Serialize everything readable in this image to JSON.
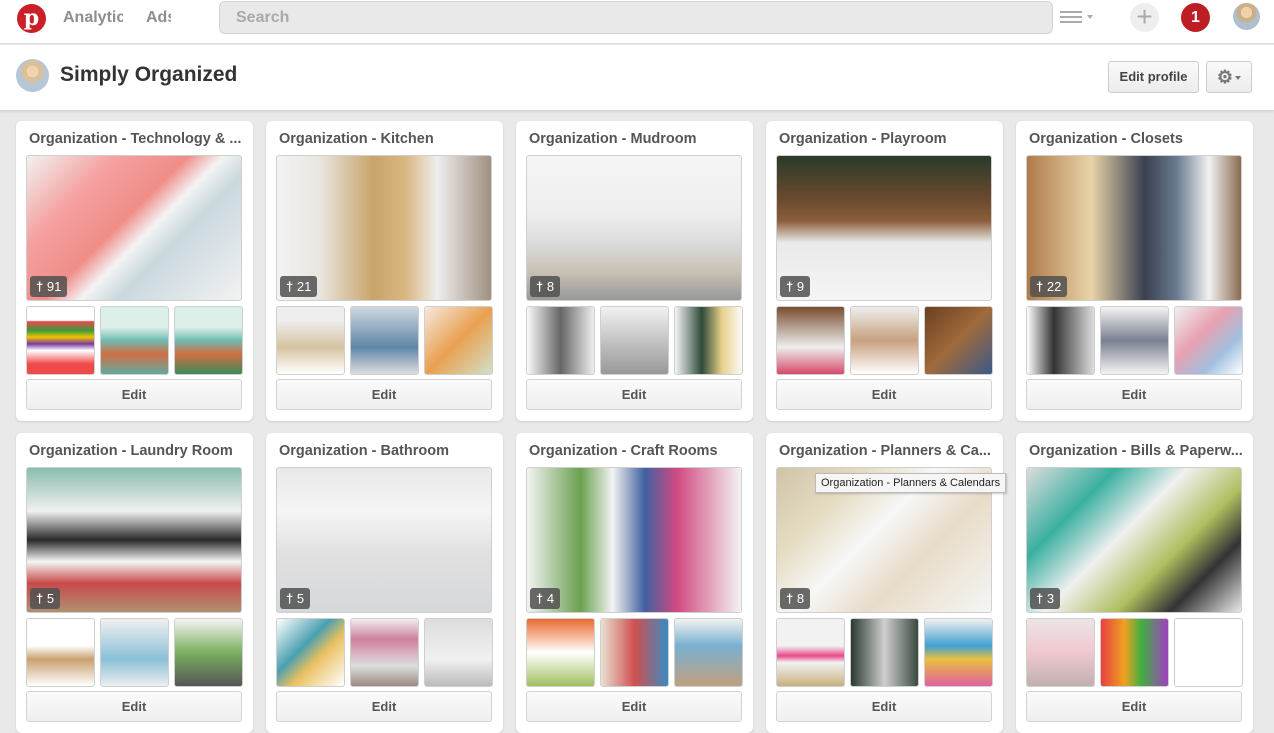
{
  "header": {
    "logo": "p",
    "nav": [
      "Analytic",
      "Ads"
    ],
    "search_placeholder": "Search",
    "add": "+",
    "notifications": "1"
  },
  "profile": {
    "name": "Simply Organized",
    "edit_profile": "Edit profile",
    "settings_icon": "⚙"
  },
  "boards": [
    {
      "title": "Organization - Technology & ...",
      "pins": "91",
      "edit": "Edit",
      "cover": "linear-gradient(135deg,#f1f1f1 0%,#f4a1a0 25%,#f08d88 45%,#f3f3f3 55%,#c9d8de 65%,#f2f2f2 100%)",
      "thumbs": [
        "linear-gradient(#fff 20%,#e64a4a 22%,#3a9a3a 35%,#f2c200 45%,#7a3aa0 55%,#fff 65%,#ef4a4a 85%)",
        "linear-gradient(#dcefe8 30%,#6fbcb2 50%,#d06f43 70%,#62a9a0)",
        "linear-gradient(#dcefe8 30%,#6fbcb2 50%,#d06f43 70%,#3d8a5a)"
      ]
    },
    {
      "title": "Organization - Kitchen",
      "pins": "21",
      "edit": "Edit",
      "cover": "linear-gradient(90deg,#f3f3f3 0%,#e9e6e0 20%,#c8a46a 45%,#d9b780 60%,#eee 75%,#a08f80 100%)",
      "thumbs": [
        "linear-gradient(#eee 20%,#d6c4a0 60%,#fff)",
        "linear-gradient(#cfd8e0,#5f86a8 60%,#ddd)",
        "linear-gradient(135deg,#f5e9e0,#e9a050 50%,#d3e0c9)"
      ]
    },
    {
      "title": "Organization - Mudroom",
      "pins": "8",
      "edit": "Edit",
      "cover": "linear-gradient(#f5f5f5 0%,#eee 40%,#dcdcdc 60%,#c9c2b5 80%,#999 100%)",
      "thumbs": [
        "linear-gradient(90deg,#fafafa,#666 50%,#eee)",
        "linear-gradient(#f2f2f2,#bbb 60%,#999)",
        "linear-gradient(90deg,#f5f5f5,#2f4a3a 40%,#e8d08a 70%,#fafafa)"
      ]
    },
    {
      "title": "Organization - Playroom",
      "pins": "9",
      "edit": "Edit",
      "cover": "linear-gradient(#2a3a2a 0%,#6b4a2e 30%,#8a5e3a 45%,#e9e9e9 60%,#f5f5f5 100%)",
      "thumbs": [
        "linear-gradient(#7a4e30,#eee 60%,#d64a6a)",
        "linear-gradient(#eee,#c8a080 50%,#fff)",
        "linear-gradient(135deg,#6a4022,#a06a3a 50%,#3a5a8a)"
      ]
    },
    {
      "title": "Organization - Closets",
      "pins": "22",
      "edit": "Edit",
      "cover": "linear-gradient(90deg,#b07a4a 0%,#e8d4a8 30%,#3a4050 55%,#6a7a90 70%,#f2f2f2 85%,#8a6a50 100%)",
      "thumbs": [
        "linear-gradient(90deg,#fff,#333 40%,#ddd)",
        "linear-gradient(#f4f4f4,#7a8090 50%,#f4f4f4)",
        "linear-gradient(135deg,#f0f0f0,#e8a0b0 40%,#a0c0e0 70%,#fff)"
      ]
    },
    {
      "title": "Organization - Laundry Room",
      "pins": "5",
      "edit": "Edit",
      "cover": "linear-gradient(#8abcb0 0%,#f0f0f0 30%,#2a2a2a 50%,#f5f5f5 65%,#c84a4a 80%,#b09070 100%)",
      "thumbs": [
        "linear-gradient(#fff 40%,#c9a070 60%,#fff)",
        "linear-gradient(#f0f0f0,#8ac0d8 60%,#eee)",
        "linear-gradient(#f4f4f4,#7ab060 50%,#555)"
      ]
    },
    {
      "title": "Organization - Bathroom",
      "pins": "5",
      "edit": "Edit",
      "cover": "linear-gradient(#e8e8e8 0%,#f5f5f5 30%,#e0e0e0 60%,#d5d8dc 100%)",
      "thumbs": [
        "linear-gradient(135deg,#fff,#4aa0b0 40%,#e8c060 60%,#fff)",
        "linear-gradient(#eee,#d080a0 30%,#ddd 70%,#9a8a80)",
        "linear-gradient(#ddd,#f0f0f0 60%,#bbb)"
      ]
    },
    {
      "title": "Organization - Craft Rooms",
      "pins": "4",
      "edit": "Edit",
      "cover": "linear-gradient(90deg,#f3f3f3 0%,#6aa050 25%,#f3f3f3 40%,#4060a0 55%,#d04a80 70%,#f3f3f3 100%)",
      "thumbs": [
        "linear-gradient(#e86a30,#fff 50%,#a0c060)",
        "linear-gradient(90deg,#e8e0d0,#d05050 50%,#3a8ac0)",
        "linear-gradient(#f2f2f2,#7ab0d0 40%,#c0a080)"
      ]
    },
    {
      "title": "Organization - Planners & Ca...",
      "pins": "8",
      "edit": "Edit",
      "cover": "linear-gradient(135deg,#cfc4a8 0%,#e6dcc2 25%,#f7f7f7 45%,#e8dcc8 65%,#f5f5f5 100%)",
      "thumbs": [
        "linear-gradient(#f2f2f2 40%,#e84a8a 55%,#f2f2f2 65%,#c8b080)",
        "linear-gradient(90deg,#2a3a30,#cfcfcf 50%,#3a4a40)",
        "linear-gradient(#f0f0f0,#40a0d0 40%,#e8c040 60%,#e060a0)"
      ]
    },
    {
      "title": "Organization - Bills & Paperw...",
      "pins": "3",
      "edit": "Edit",
      "cover": "linear-gradient(135deg,#dcdcdc 0%,#3ab0a0 25%,#f0f0f0 45%,#b0c060 65%,#333 80%,#e8e8e8 100%)",
      "thumbs": [
        "linear-gradient(#ece4e4,#f0c8d0 50%,#c0b0b0)",
        "linear-gradient(90deg,#e84040,#f0a020 35%,#40b040 60%,#a040c0)",
        "linear-gradient(#fff,#fff)"
      ]
    }
  ],
  "tooltip": "Organization - Planners & Calendars"
}
